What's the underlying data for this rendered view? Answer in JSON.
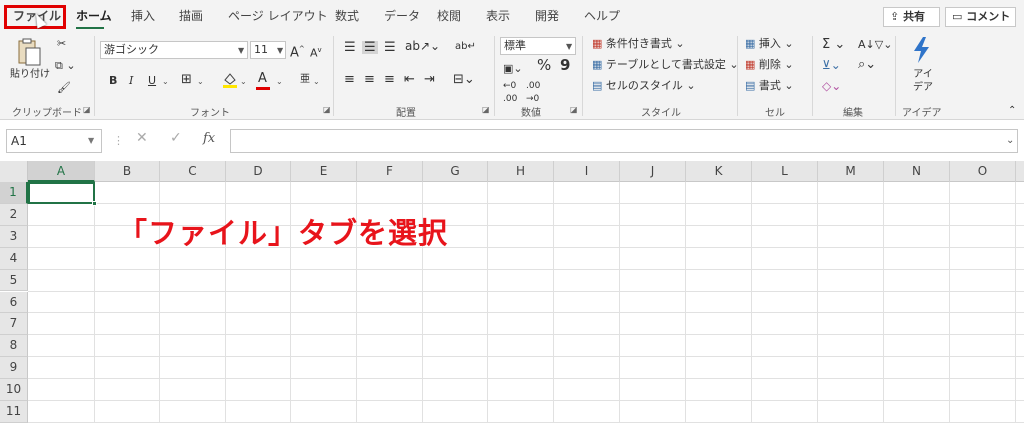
{
  "tabs": [
    {
      "label": "ファイル",
      "active": false,
      "highlighted": true
    },
    {
      "label": "ホーム",
      "active": true
    },
    {
      "label": "挿入"
    },
    {
      "label": "描画"
    },
    {
      "label": "ページ レイアウト"
    },
    {
      "label": "数式"
    },
    {
      "label": "データ"
    },
    {
      "label": "校閲"
    },
    {
      "label": "表示"
    },
    {
      "label": "開発"
    },
    {
      "label": "ヘルプ"
    }
  ],
  "top_buttons": {
    "share": "共有",
    "comment": "コメント"
  },
  "ribbon": {
    "clipboard": {
      "paste": "貼り付け",
      "label": "クリップボード"
    },
    "font": {
      "font_name": "游ゴシック",
      "font_size": "11",
      "bold": "B",
      "italic": "I",
      "underline": "U",
      "font_color_letter": "A",
      "label": "フォント"
    },
    "alignment": {
      "label": "配置"
    },
    "number": {
      "format": "標準",
      "percent": "%",
      "comma": "9",
      "label": "数値"
    },
    "styles": {
      "conditional": "条件付き書式",
      "table": "テーブルとして書式設定",
      "cell_style": "セルのスタイル",
      "label": "スタイル"
    },
    "cells": {
      "insert": "挿入",
      "delete": "削除",
      "format": "書式",
      "label": "セル"
    },
    "editing": {
      "label": "編集"
    },
    "ideas": {
      "button": "アイ\nデア",
      "label": "アイデア"
    }
  },
  "formula_bar": {
    "name_box": "A1",
    "fx": "fx",
    "formula": ""
  },
  "columns": [
    "A",
    "B",
    "C",
    "D",
    "E",
    "F",
    "G",
    "H",
    "I",
    "J",
    "K",
    "L",
    "M",
    "N",
    "O"
  ],
  "rows": [
    "1",
    "2",
    "3",
    "4",
    "5",
    "6",
    "7",
    "8",
    "9",
    "10",
    "11"
  ],
  "annotation_text": "「ファイル」タブを選択",
  "colors": {
    "accent": "#217346",
    "highlight": "#e00000",
    "annotation": "#e8141b"
  }
}
